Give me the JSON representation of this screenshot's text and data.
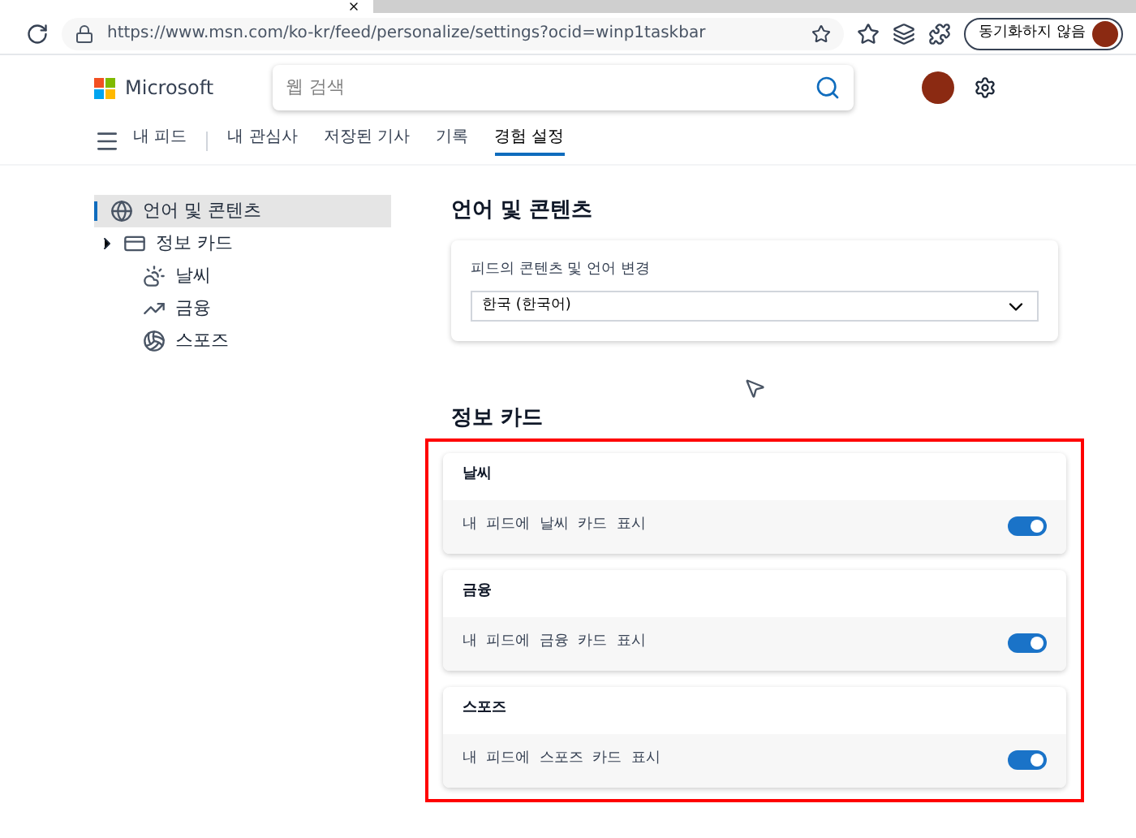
{
  "browser": {
    "url": "https://www.msn.com/ko-kr/feed/personalize/settings?ocid=winp1taskbar",
    "sync_button": "동기화하지 않음"
  },
  "header": {
    "logo": "Microsoft",
    "search": {
      "placeholder": "웹 검색"
    }
  },
  "nav": [
    {
      "label": "내 피드",
      "selected": false
    },
    {
      "label": "내 관심사",
      "selected": false
    },
    {
      "label": "저장된 기사",
      "selected": false
    },
    {
      "label": "기록",
      "selected": false
    },
    {
      "label": "경험 설정",
      "selected": true
    }
  ],
  "sidebar": {
    "items": [
      {
        "label": "언어 및 콘텐츠",
        "kind": "globe",
        "selected": true
      },
      {
        "label": "정보 카드",
        "kind": "card",
        "selected": false,
        "expanded": false,
        "children": [
          {
            "label": "날씨",
            "kind": "weather",
            "selected": false
          },
          {
            "label": "금융",
            "kind": "finance",
            "selected": false
          },
          {
            "label": "스포즈",
            "kind": "sports",
            "selected": false
          }
        ]
      }
    ]
  },
  "language_section": {
    "title": "언어 및 콘텐츠",
    "field_label": "피드의 콘텐츠 및 언어 변경",
    "value": "한국 (한국어)"
  },
  "cards_section": {
    "title": "정보 카드",
    "highlighted": true,
    "cards": [
      {
        "title": "날씨",
        "description": "내  피드에  날씨  카드  표시",
        "on": true
      },
      {
        "title": "금융",
        "description": "내  피드에  금융  카드  표시",
        "on": true
      },
      {
        "title": "스포즈",
        "description": "내  피드에  스포즈  카드  표시",
        "on": true
      }
    ]
  }
}
